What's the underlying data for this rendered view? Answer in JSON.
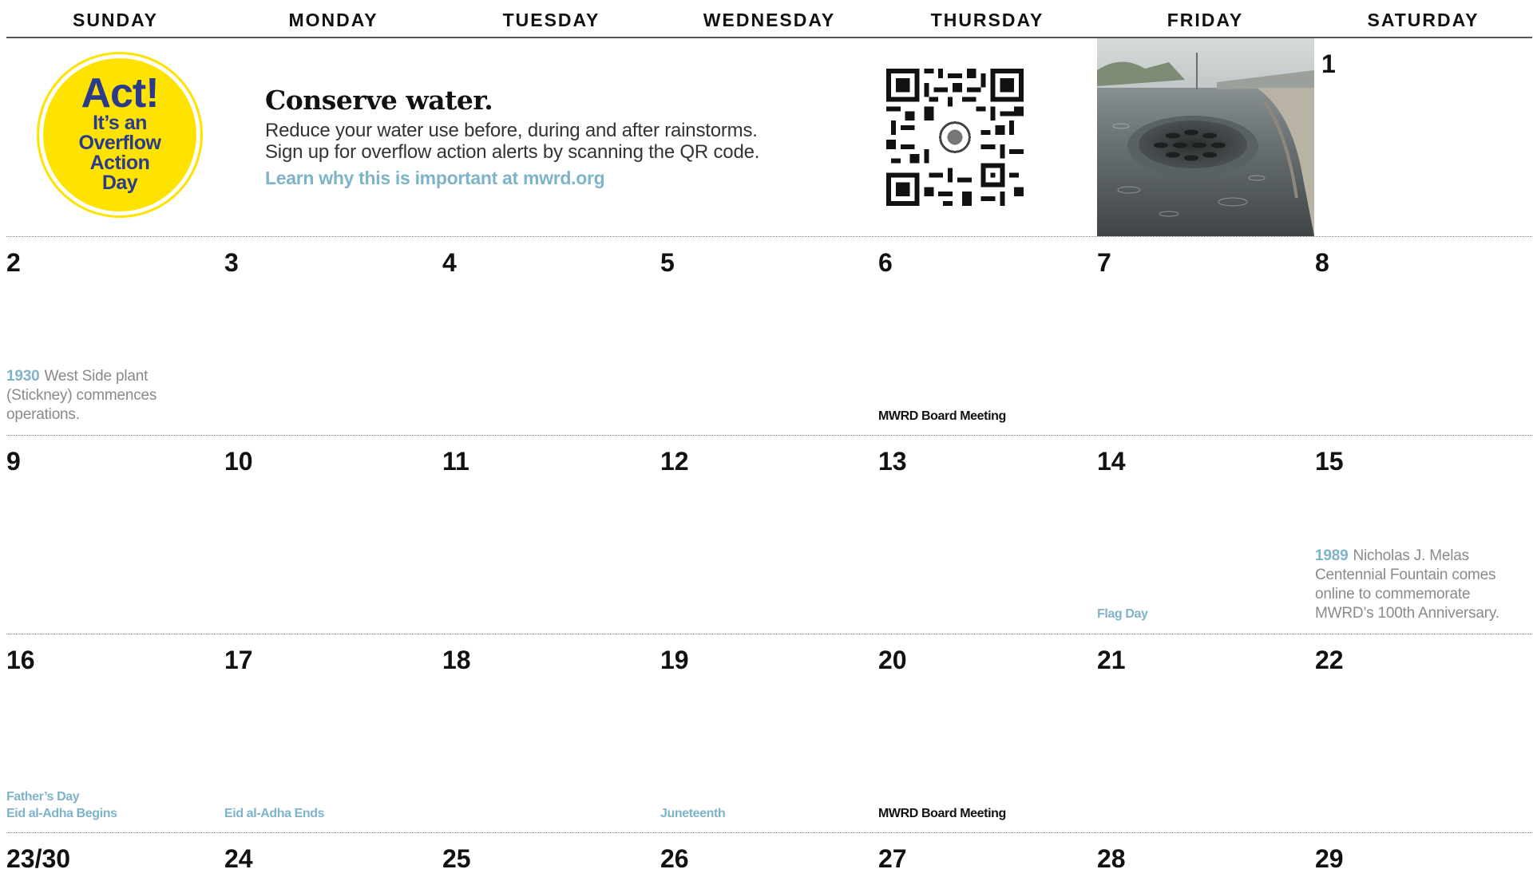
{
  "weekdays": [
    "SUNDAY",
    "MONDAY",
    "TUESDAY",
    "WEDNESDAY",
    "THURSDAY",
    "FRIDAY",
    "SATURDAY"
  ],
  "banner": {
    "badge": {
      "title": "Act!",
      "line1": "It’s an",
      "line2": "Overflow",
      "line3": "Action",
      "line4": "Day",
      "color": "#ffe300",
      "text_color": "#2a3a8c"
    },
    "headline": "Conserve water.",
    "body_line1": "Reduce your water use before, during and after rainstorms.",
    "body_line2": "Sign up for overflow action alerts by scanning the QR code.",
    "link": "Learn why this is important at mwrd.org",
    "qr_icon": "qr-code-icon",
    "photo": "storm-drain-in-rain-photo"
  },
  "days": {
    "d1": "1",
    "d2": "2",
    "d3": "3",
    "d4": "4",
    "d5": "5",
    "d6": "6",
    "d7": "7",
    "d8": "8",
    "d9": "9",
    "d10": "10",
    "d11": "11",
    "d12": "12",
    "d13": "13",
    "d14": "14",
    "d15": "15",
    "d16": "16",
    "d17": "17",
    "d18": "18",
    "d19": "19",
    "d20": "20",
    "d21": "21",
    "d22": "22",
    "d23": "23/30",
    "d24": "24",
    "d25": "25",
    "d26": "26",
    "d27": "27",
    "d28": "28",
    "d29": "29"
  },
  "history": {
    "day2": {
      "year": "1930",
      "text": "West Side plant (Stickney) commences operations."
    },
    "day15": {
      "year": "1989",
      "text": "Nicholas J. Melas Centennial Fountain comes online to commemorate MWRD’s 100th Anniversary."
    }
  },
  "events": {
    "day6": "MWRD Board Meeting",
    "day14": "Flag Day",
    "day16_a": "Father’s Day",
    "day16_b": "Eid al-Adha Begins",
    "day17": "Eid al-Adha Ends",
    "day19": "Juneteenth",
    "day20": "MWRD Board Meeting"
  },
  "colors": {
    "accent_blue": "#7fb3c9",
    "text_dark": "#111111",
    "history_gray": "#8a8a8a"
  }
}
